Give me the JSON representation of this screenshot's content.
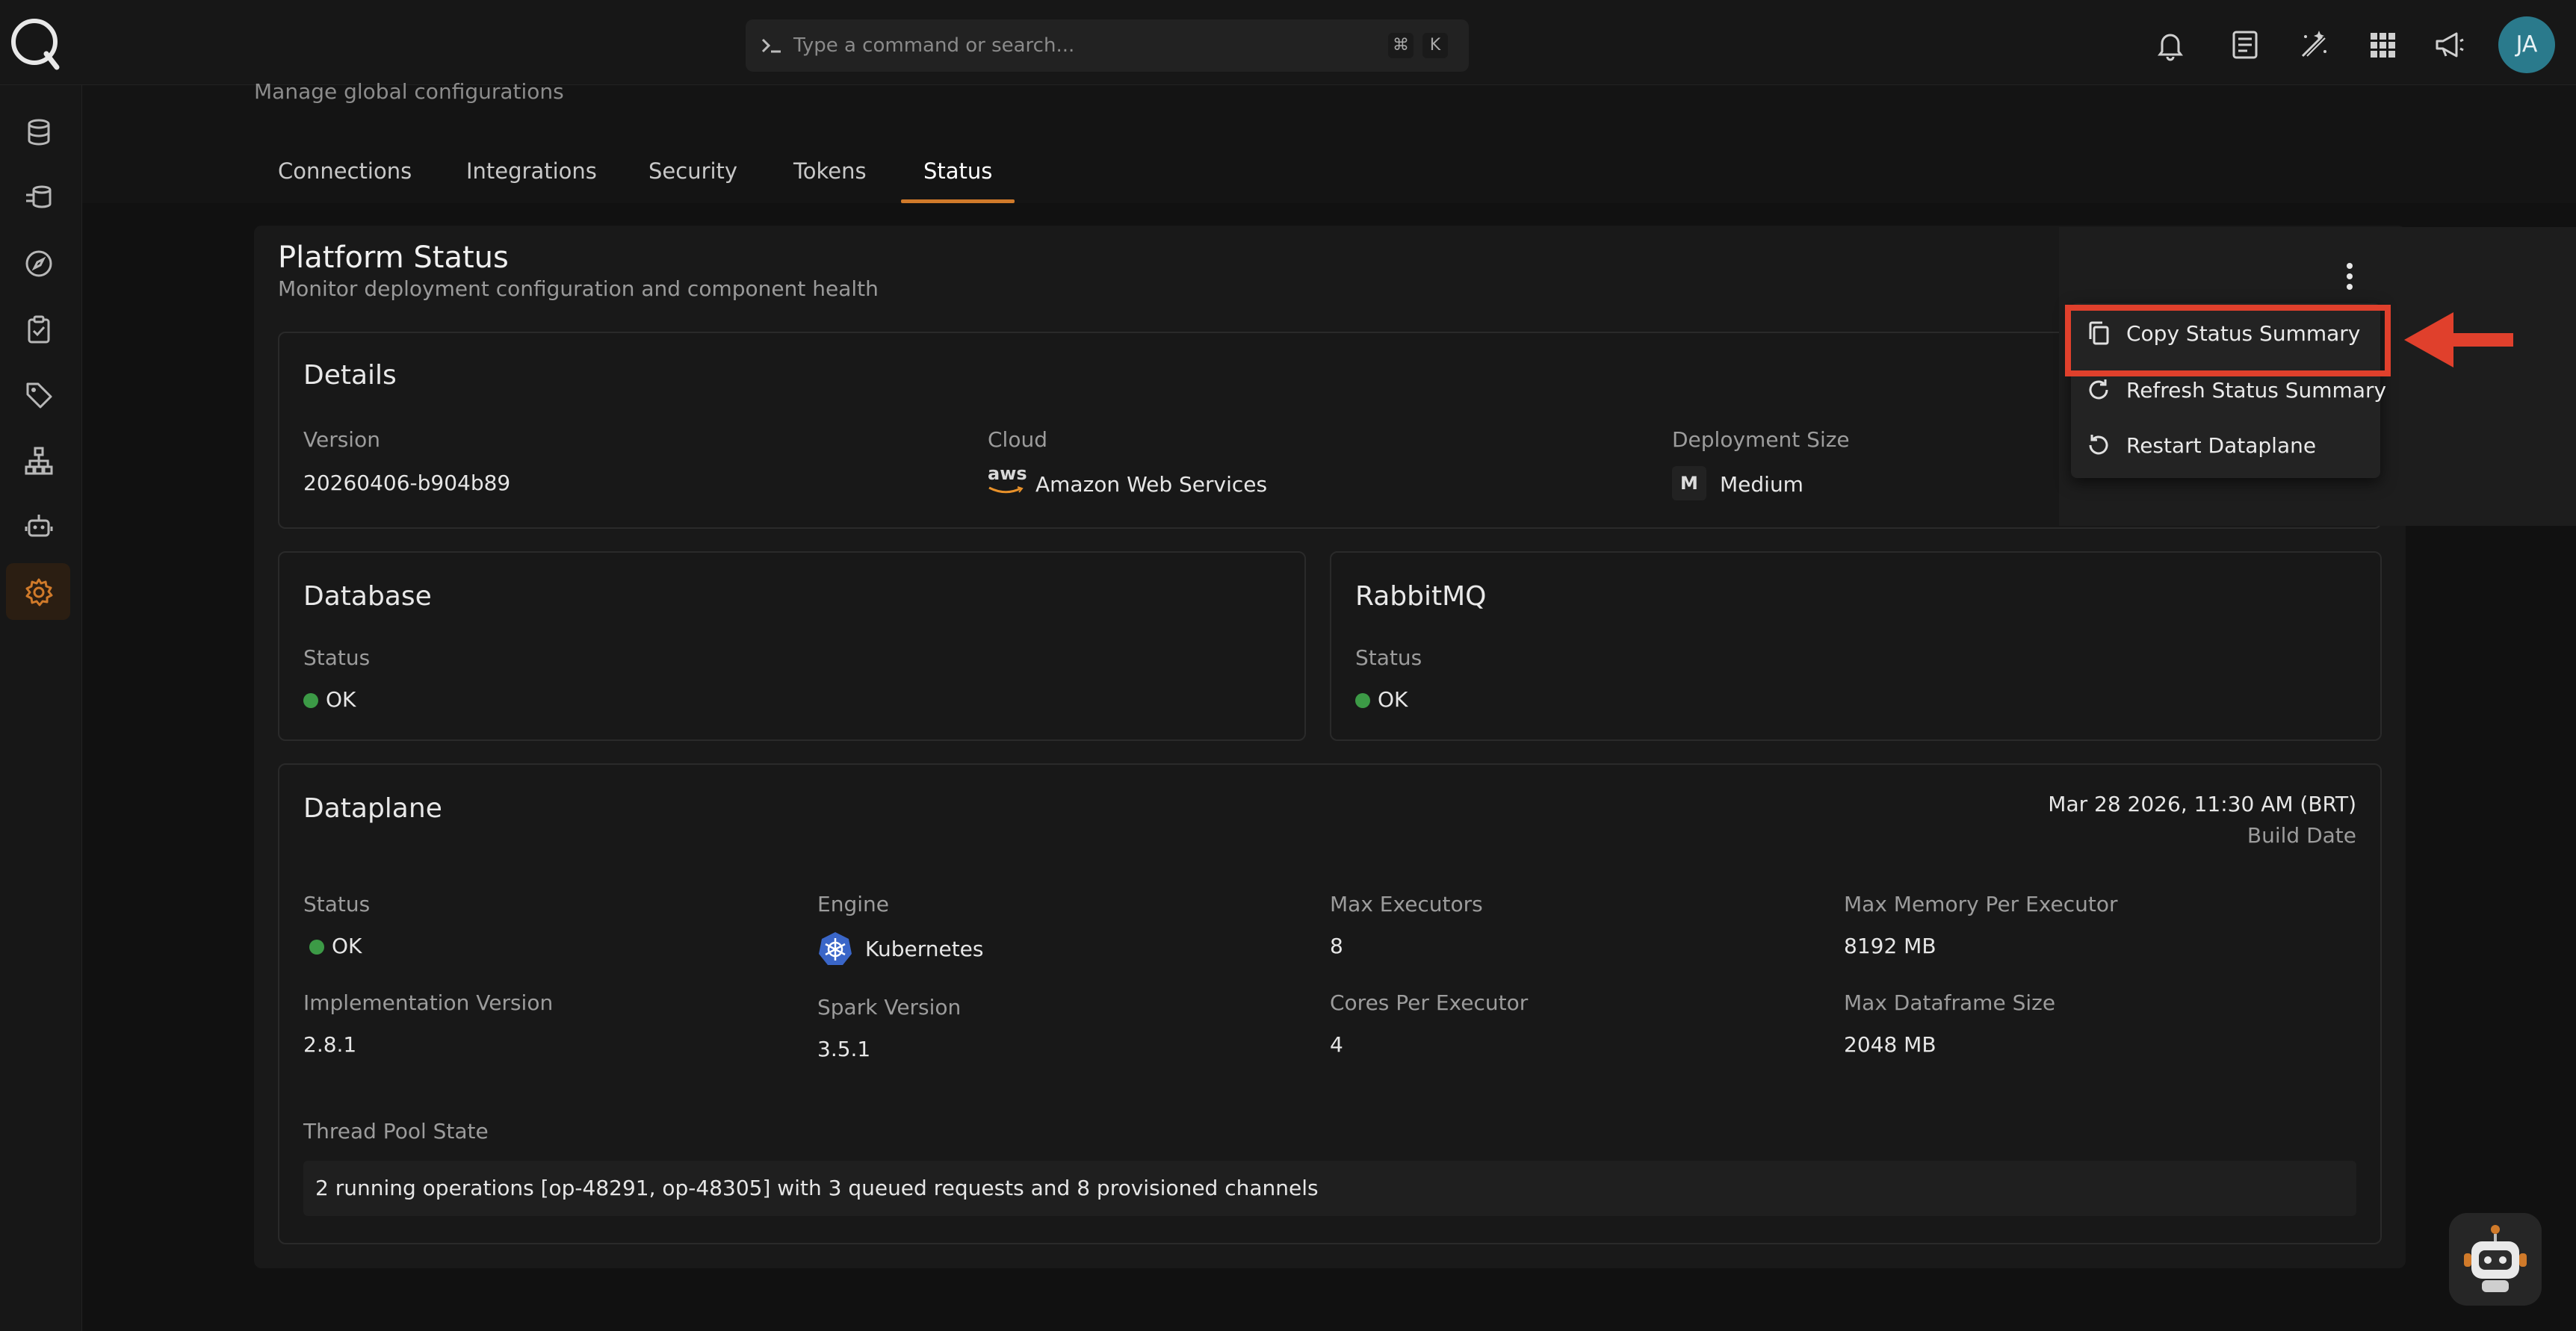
{
  "topbar": {
    "search_placeholder": "Type a command or search...",
    "kbd_cmd": "⌘",
    "kbd_k": "K",
    "icons": [
      "bell-icon",
      "docs-icon",
      "magic-wand-icon",
      "apps-grid-icon",
      "megaphone-icon"
    ],
    "avatar_initials": "JA"
  },
  "sidebar": {
    "items": [
      {
        "icon": "database-icon"
      },
      {
        "icon": "datasets-stack-icon"
      },
      {
        "icon": "compass-icon"
      },
      {
        "icon": "clipboard-check-icon"
      },
      {
        "icon": "tag-icon"
      },
      {
        "icon": "hierarchy-icon"
      },
      {
        "icon": "robot-icon"
      },
      {
        "icon": "settings-gear-icon",
        "active": true
      }
    ]
  },
  "page": {
    "subtitle": "Manage global configurations",
    "tabs": [
      "Connections",
      "Integrations",
      "Security",
      "Tokens",
      "Status"
    ],
    "active_tab": "Status"
  },
  "platform": {
    "title": "Platform Status",
    "subtitle": "Monitor deployment configuration and component health"
  },
  "details": {
    "title": "Details",
    "version_label": "Version",
    "version_value": "20260406-b904b89",
    "cloud_label": "Cloud",
    "cloud_logo_text": "aws",
    "cloud_value": "Amazon Web Services",
    "size_label": "Deployment Size",
    "size_badge": "M",
    "size_value": "Medium"
  },
  "database": {
    "title": "Database",
    "status_label": "Status",
    "status_value": "OK"
  },
  "rabbitmq": {
    "title": "RabbitMQ",
    "status_label": "Status",
    "status_value": "OK"
  },
  "dataplane": {
    "title": "Dataplane",
    "build_date": "Mar 28 2026, 11:30 AM (BRT)",
    "build_date_label": "Build Date",
    "status_label": "Status",
    "status_value": "OK",
    "engine_label": "Engine",
    "engine_value": "Kubernetes",
    "max_executors_label": "Max Executors",
    "max_executors_value": "8",
    "max_memory_label": "Max Memory Per Executor",
    "max_memory_value": "8192 MB",
    "impl_version_label": "Implementation Version",
    "impl_version_value": "2.8.1",
    "spark_version_label": "Spark Version",
    "spark_version_value": "3.5.1",
    "cores_label": "Cores Per Executor",
    "cores_value": "4",
    "max_df_label": "Max Dataframe Size",
    "max_df_value": "2048 MB",
    "thread_pool_label": "Thread Pool State",
    "thread_pool_value": "2 running operations [op-48291, op-48305] with 3 queued requests and 8 provisioned channels"
  },
  "menu": {
    "items": [
      {
        "label": "Copy Status Summary",
        "icon": "copy-icon"
      },
      {
        "label": "Refresh Status Summary",
        "icon": "refresh-icon"
      },
      {
        "label": "Restart Dataplane",
        "icon": "restart-icon"
      }
    ]
  },
  "colors": {
    "accent": "#d07a2a",
    "ok": "#3c9a46",
    "highlight": "#e0402c",
    "avatar": "#2a7a8c"
  }
}
